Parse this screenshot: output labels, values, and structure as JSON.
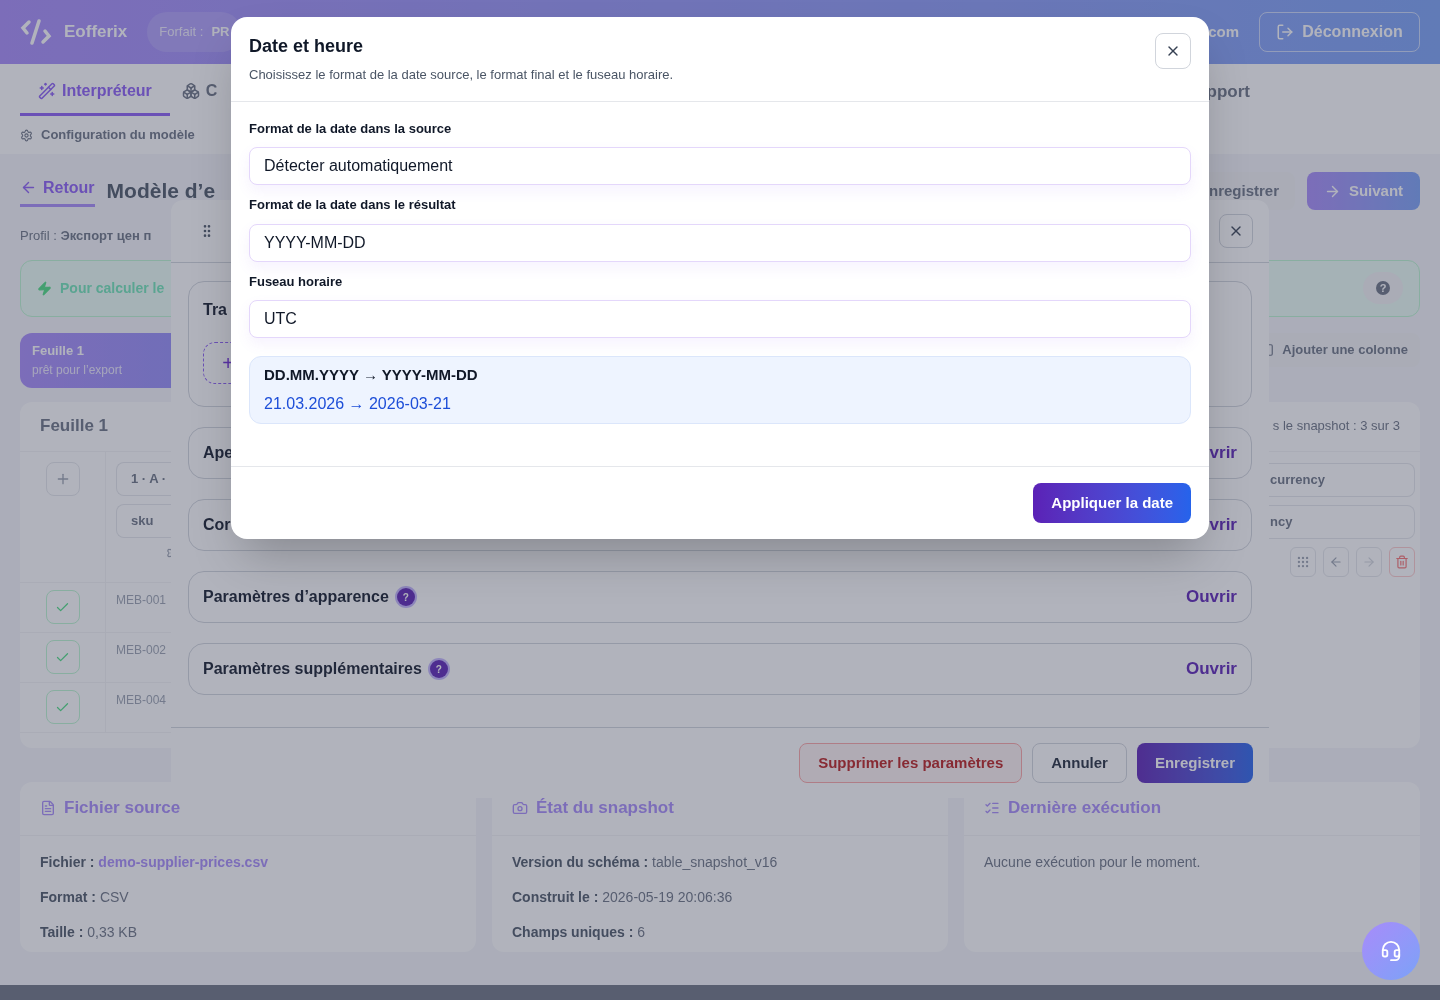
{
  "header": {
    "brand": "Eofferix",
    "plan_label": "Forfait :",
    "plan_value": "PR",
    "user_email": "com",
    "logout_button": "Déconnexion"
  },
  "tabs": [
    {
      "label": "Interpréteur",
      "selected": true
    },
    {
      "label": "C",
      "selected": false
    },
    {
      "label": "pport",
      "selected": false
    }
  ],
  "breadcrumb": "Configuration du modèle",
  "back_link": "Retour",
  "page_title": "Modèle d’e",
  "actions": [
    {
      "label": "nregistrer",
      "kind": "secondary"
    },
    {
      "label": "Suivant",
      "kind": "primary"
    }
  ],
  "profile": {
    "label": "Profil :",
    "value": "Экспорт цен п"
  },
  "hint": {
    "text": "Pour calculer le",
    "help": "?"
  },
  "sheet_tab": {
    "name": "Feuille 1",
    "status": "prêt pour l’export",
    "selected": true
  },
  "add_column_button": "Ajouter une colonne",
  "sheet_table": {
    "title": "Feuille 1",
    "snapshot_info": "s le snapshot : 3 sur 3",
    "header_cells": [
      "1 · A ·",
      "sku"
    ],
    "right_header_cells": [
      "currency",
      "ncy"
    ],
    "rows": [
      {
        "value": "MEB-001",
        "checked": true
      },
      {
        "value": "MEB-002",
        "checked": true
      },
      {
        "value": "MEB-004",
        "checked": true
      }
    ]
  },
  "info_cards": [
    {
      "title": "Fichier source",
      "fields": [
        {
          "label": "Fichier :",
          "value": "demo-supplier-prices.csv",
          "kind": "link"
        },
        {
          "label": "Format :",
          "value": "CSV",
          "kind": "text"
        },
        {
          "label": "Taille :",
          "value": "0,33 KB",
          "kind": "text"
        }
      ]
    },
    {
      "title": "État du snapshot",
      "fields": [
        {
          "label": "Version du schéma :",
          "value": "table_snapshot_v16",
          "kind": "text"
        },
        {
          "label": "Construit le :",
          "value": "2026-05-19 20:06:36",
          "kind": "text"
        },
        {
          "label": "Champs uniques :",
          "value": "6",
          "kind": "text"
        }
      ]
    },
    {
      "title": "Dernière exécution",
      "message": "Aucune exécution pour le moment."
    }
  ],
  "column_dialog": {
    "sections": [
      {
        "title": "Tra",
        "kind": "builder",
        "add": "+"
      },
      {
        "title": "Ape",
        "kind": "collapsed",
        "action": "vrir"
      },
      {
        "title": "Cor",
        "kind": "collapsed",
        "action": "vrir"
      },
      {
        "title": "Paramètres d’apparence",
        "kind": "collapsed",
        "help": "?",
        "action": "Ouvrir"
      },
      {
        "title": "Paramètres supplémentaires",
        "kind": "collapsed",
        "help": "?",
        "action": "Ouvrir"
      }
    ],
    "buttons": [
      {
        "label": "Supprimer les paramètres",
        "kind": "danger"
      },
      {
        "label": "Annuler",
        "kind": "secondary"
      },
      {
        "label": "Enregistrer",
        "kind": "primary"
      }
    ]
  },
  "date_dialog": {
    "title": "Date et heure",
    "subtitle": "Choisissez le format de la date source, le format final et le fuseau horaire.",
    "fields": [
      {
        "label": "Format de la date dans la source",
        "value": "Détecter automatiquement"
      },
      {
        "label": "Format de la date dans le résultat",
        "value": "YYYY-MM-DD"
      },
      {
        "label": "Fuseau horaire",
        "value": "UTC"
      }
    ],
    "preview": {
      "pattern": "DD.MM.YYYY → YYYY-MM-DD",
      "example": "21.03.2026 → 2026-03-21"
    },
    "apply_button": "Appliquer la date"
  }
}
